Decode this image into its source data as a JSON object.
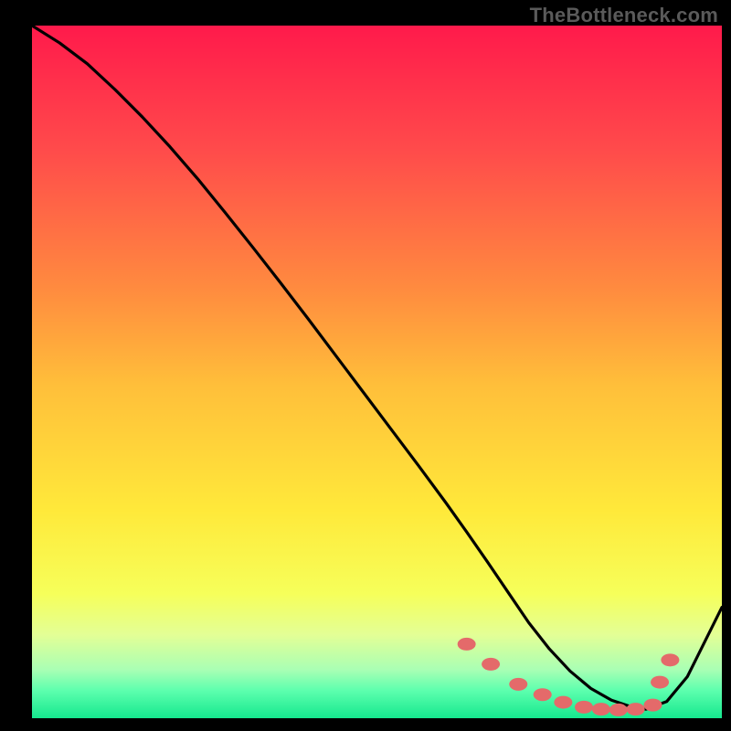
{
  "watermark": "TheBottleneck.com",
  "chart_data": {
    "type": "line",
    "title": "",
    "xlabel": "",
    "ylabel": "",
    "xlim": [
      0,
      100
    ],
    "ylim": [
      0,
      100
    ],
    "grid": false,
    "background_gradient": {
      "orientation": "vertical",
      "stops": [
        {
          "pos": 0.0,
          "color": "#ff1a4b"
        },
        {
          "pos": 0.18,
          "color": "#ff4b4b"
        },
        {
          "pos": 0.38,
          "color": "#ff8b3f"
        },
        {
          "pos": 0.52,
          "color": "#ffbf3a"
        },
        {
          "pos": 0.7,
          "color": "#ffe93a"
        },
        {
          "pos": 0.82,
          "color": "#f6ff5a"
        },
        {
          "pos": 0.88,
          "color": "#e3ff96"
        },
        {
          "pos": 0.93,
          "color": "#a9ffb4"
        },
        {
          "pos": 0.96,
          "color": "#5dffae"
        },
        {
          "pos": 1.0,
          "color": "#15e88e"
        }
      ]
    },
    "series": [
      {
        "name": "curve",
        "color": "#000000",
        "x": [
          0,
          4,
          8,
          12,
          16,
          20,
          24,
          28,
          32,
          36,
          40,
          44,
          48,
          52,
          56,
          60,
          63,
          66,
          69,
          72,
          75,
          78,
          81,
          84,
          87,
          89,
          92,
          95,
          97,
          100
        ],
        "y": [
          100,
          97.5,
          94.5,
          90.8,
          86.8,
          82.5,
          77.9,
          73.0,
          68.0,
          62.9,
          57.7,
          52.4,
          47.1,
          41.8,
          36.5,
          31.1,
          26.9,
          22.6,
          18.2,
          13.8,
          10.0,
          6.8,
          4.3,
          2.6,
          1.6,
          1.3,
          2.4,
          6.0,
          10.0,
          16.0
        ]
      }
    ],
    "markers": {
      "name": "highlight-points",
      "color": "#e46a6a",
      "x": [
        63,
        66.5,
        70.5,
        74,
        77,
        80,
        82.5,
        85,
        87.5,
        90,
        91,
        92.5
      ],
      "y": [
        10.7,
        7.8,
        4.9,
        3.4,
        2.3,
        1.6,
        1.3,
        1.2,
        1.3,
        1.9,
        5.2,
        8.4
      ]
    }
  }
}
